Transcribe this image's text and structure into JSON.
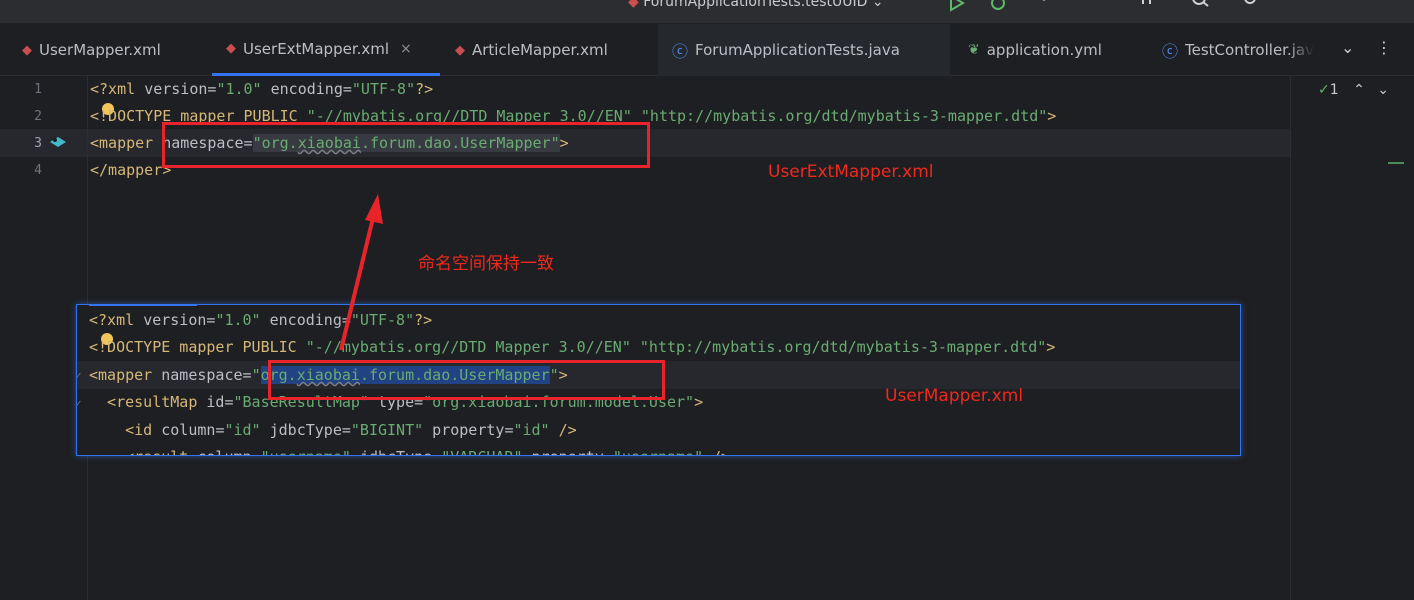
{
  "toolbar": {
    "run_config": "ForumApplicationTests.testUUID",
    "icons": [
      "run-icon",
      "debug-icon",
      "more-icon",
      "add-user-icon",
      "search-icon",
      "settings-icon"
    ]
  },
  "tabs": [
    {
      "label": "UserMapper.xml",
      "icon": "mybatis-icon"
    },
    {
      "label": "UserExtMapper.xml",
      "icon": "mybatis-icon",
      "active": true,
      "close": "×"
    },
    {
      "label": "ArticleMapper.xml",
      "icon": "mybatis-icon"
    },
    {
      "label": "ForumApplicationTests.java",
      "icon": "class-icon"
    },
    {
      "label": "application.yml",
      "icon": "spring-icon"
    },
    {
      "label": "TestController.jav",
      "icon": "class-icon"
    }
  ],
  "tab_overflow": "⌄",
  "tab_menu": "⋮",
  "gutter": {
    "line_numbers": [
      "1",
      "2",
      "3",
      "4"
    ]
  },
  "inspection": {
    "count": "1",
    "up": "⌃",
    "down": "⌄"
  },
  "editor_lines": {
    "l1": {
      "a": "<?xml ",
      "b": "version",
      "c": "=",
      "d": "\"1.0\"",
      "e": " encoding",
      "f": "=",
      "g": "\"UTF-8\"",
      "h": "?>"
    },
    "l2": {
      "a": "<!DOCTYPE mapper PUBLIC ",
      "b": "\"-//mybatis.org//DTD Mapper 3.0//EN\"",
      "c": " ",
      "d": "\"http://mybatis.org/dtd/mybatis-3-mapper.dtd\"",
      "e": ">"
    },
    "l3": {
      "a": "<mapper ",
      "b": "namespace",
      "c": "=",
      "d": "\"org.",
      "e": "xiaobai",
      "f": ".forum.dao.UserMapper\"",
      "g": ">"
    },
    "l4": {
      "a": "</mapper>"
    }
  },
  "inset_lines": {
    "l1": {
      "a": "<?xml ",
      "b": "version",
      "c": "=",
      "d": "\"1.0\"",
      "e": " encoding",
      "f": "=",
      "g": "\"UTF-8\"",
      "h": "?>"
    },
    "l2": {
      "a": "<!DOCTYPE mapper PUBLIC ",
      "b": "\"-//mybatis.org//DTD Mapper 3.0//EN\"",
      "c": " ",
      "d": "\"http://mybatis.org/dtd/mybatis-3-mapper.dtd\"",
      "e": ">"
    },
    "l3": {
      "a": "<mapper ",
      "b": "namespace",
      "c": "=",
      "d": "\"",
      "e": "org.",
      "f": "xiaobai",
      "g": ".forum.dao.UserMapper",
      "h": "\"",
      "i": ">"
    },
    "l4": {
      "a": "  <resultMap ",
      "b": "id",
      "c": "=",
      "d": "\"BaseResultMap\"",
      "e": " type",
      "f": "=",
      "g": "\"org.xiaobai.forum.model.User\"",
      "h": ">"
    },
    "l5": {
      "a": "    <id ",
      "b": "column",
      "c": "=",
      "d": "\"id\"",
      "e": " jdbcType",
      "f": "=",
      "g": "\"BIGINT\"",
      "h": " property",
      "i": "=",
      "j": "\"id\"",
      "k": " />"
    },
    "l6": {
      "a": "    <result ",
      "b": "column",
      "c": "=",
      "d": "\"username\"",
      "e": " jdbcType",
      "f": "=",
      "g": "\"VARCHAR\"",
      "h": " property",
      "i": "=",
      "j": "\"username\"",
      "k": " />"
    }
  },
  "annotations": {
    "label_top": "UserExtMapper.xml",
    "label_middle": "命名空间保持一致",
    "label_bottom": "UserMapper.xml"
  },
  "colors": {
    "annotation_red": "#e8232a",
    "accent_blue": "#3574f0",
    "tag": "#d5b778",
    "string": "#6aab73"
  }
}
